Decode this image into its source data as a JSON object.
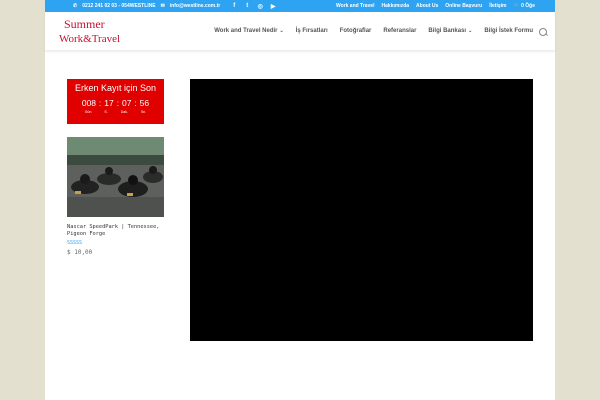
{
  "topbar": {
    "phone": "0212 241 02 03 - 054WESTLINE",
    "email": "info@westline.com.tr",
    "social": [
      "facebook-icon",
      "twitter-icon",
      "instagram-icon",
      "youtube-icon"
    ],
    "links": [
      "Work and Travel",
      "Hakkımızda",
      "About Us",
      "Online Başvuru",
      "İletişim"
    ],
    "cart": "0 Öğe"
  },
  "logo": {
    "line1": "Summer",
    "line2": "Work&Travel"
  },
  "nav": {
    "items": [
      {
        "label": "Work and Travel Nedir",
        "has_dropdown": true
      },
      {
        "label": "İş Fırsatları",
        "has_dropdown": false
      },
      {
        "label": "Fotoğraflar",
        "has_dropdown": false
      },
      {
        "label": "Referanslar",
        "has_dropdown": false
      },
      {
        "label": "Bilgi Bankası",
        "has_dropdown": true
      },
      {
        "label": "Bilgi İstek Formu",
        "has_dropdown": false
      }
    ]
  },
  "countdown": {
    "title": "Erken Kayıt için Son",
    "days": "008",
    "hours": "17",
    "minutes": "07",
    "seconds": "56",
    "labels": [
      "Gün",
      "S.",
      "Dak.",
      "Sn."
    ]
  },
  "product": {
    "name": "Nascar SpeedPark | Tennessee, Pigeon Forge",
    "rating": "SSSSS",
    "price": "$ 10,00"
  },
  "colors": {
    "accent": "#2ea3f2",
    "countdown_bg": "#e00000",
    "logo_red": "#c8102e"
  }
}
